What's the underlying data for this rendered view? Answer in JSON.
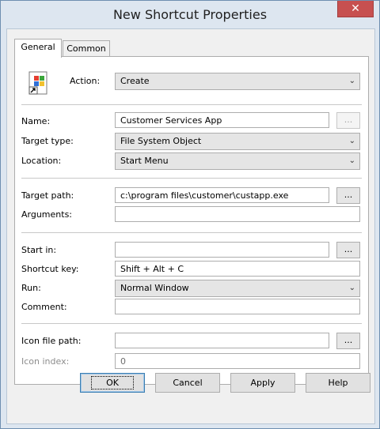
{
  "window": {
    "title": "New Shortcut Properties",
    "close_glyph": "✕"
  },
  "tabs": [
    {
      "label": "General"
    },
    {
      "label": "Common"
    }
  ],
  "action": {
    "label": "Action:",
    "value": "Create"
  },
  "name": {
    "label": "Name:",
    "value": "Customer Services App",
    "browse": "..."
  },
  "target_type": {
    "label": "Target type:",
    "value": "File System Object"
  },
  "location": {
    "label": "Location:",
    "value": "Start Menu"
  },
  "target_path": {
    "label": "Target path:",
    "value": "c:\\program files\\customer\\custapp.exe",
    "browse": "..."
  },
  "arguments": {
    "label": "Arguments:",
    "value": ""
  },
  "start_in": {
    "label": "Start in:",
    "value": "",
    "browse": "..."
  },
  "shortcut_key": {
    "label": "Shortcut key:",
    "value": "Shift + Alt + C"
  },
  "run": {
    "label": "Run:",
    "value": "Normal Window"
  },
  "comment": {
    "label": "Comment:",
    "value": ""
  },
  "icon_file_path": {
    "label": "Icon file path:",
    "value": "",
    "browse": "..."
  },
  "icon_index": {
    "label": "Icon index:",
    "value": "0"
  },
  "buttons": {
    "ok": "OK",
    "cancel": "Cancel",
    "apply": "Apply",
    "help": "Help"
  },
  "dropdown_glyph": "⌄"
}
